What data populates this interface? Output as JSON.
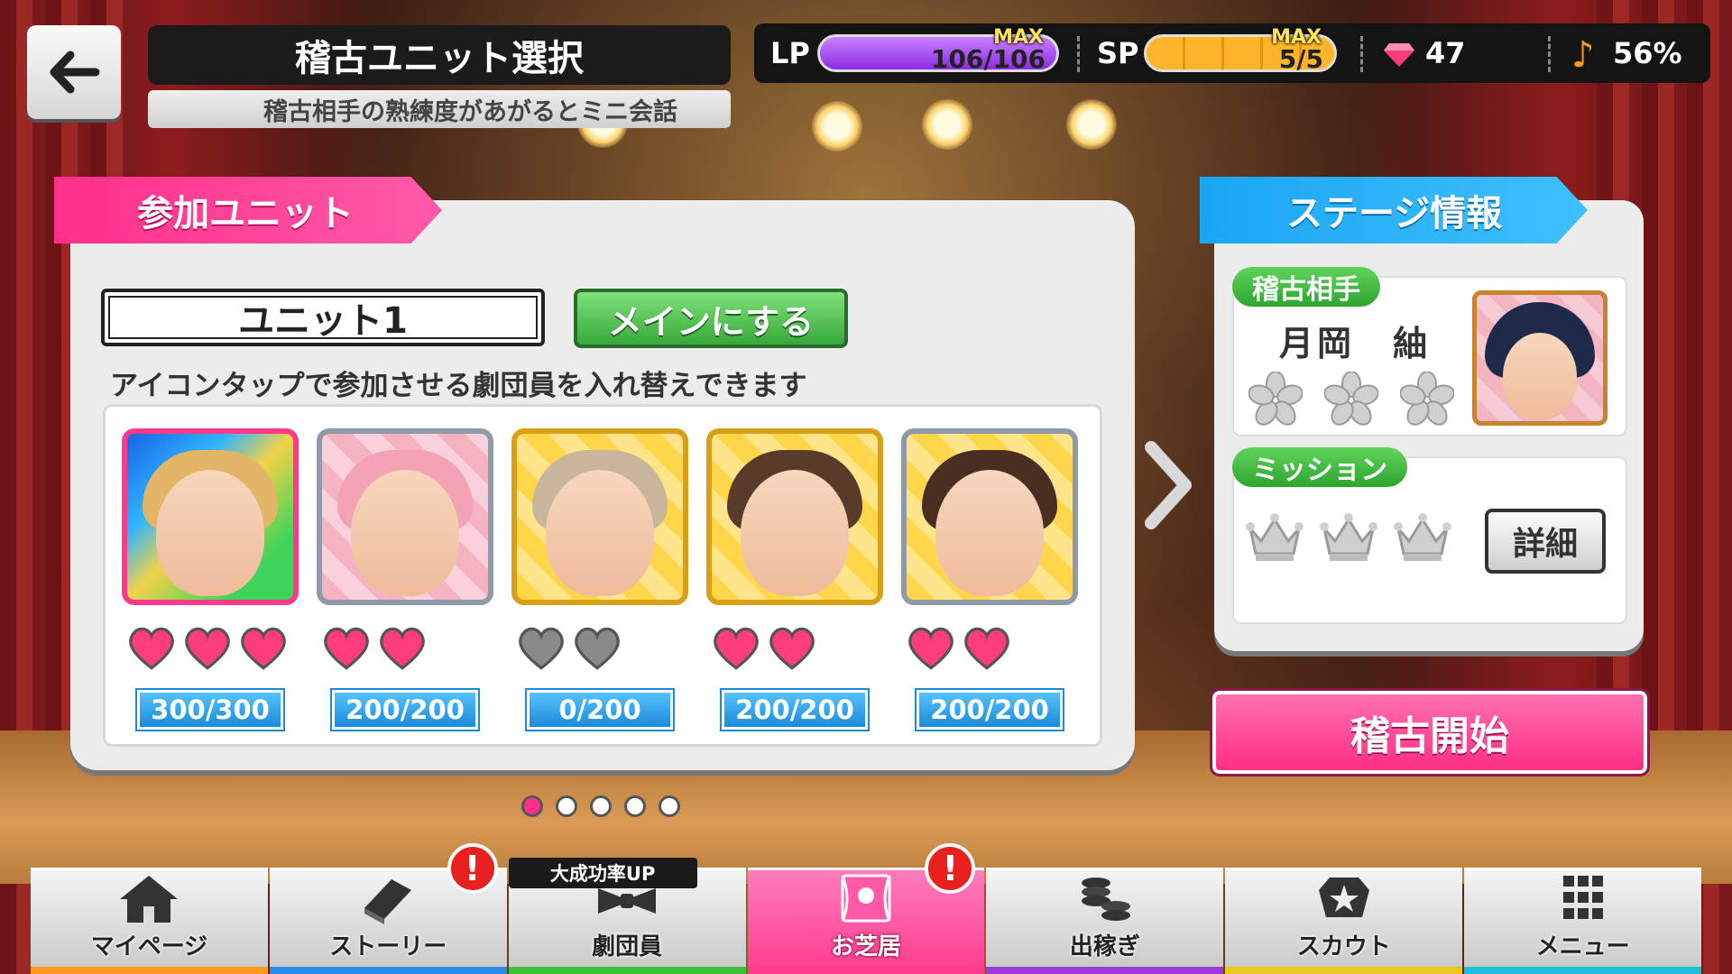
{
  "header": {
    "title": "稽古ユニット選択",
    "subtitle": "稽古相手の熟練度があがるとミニ会話"
  },
  "status": {
    "lp_label": "LP",
    "lp_value": "106/106",
    "lp_level": 1.0,
    "lp_max": "MAX",
    "sp_label": "SP",
    "sp_value": "5/5",
    "sp_level": 1.0,
    "sp_max": "MAX",
    "gems": "47",
    "note_percent": "56%"
  },
  "unit_panel": {
    "ribbon": "参加ユニット",
    "unit_name": "ユニット1",
    "main_button": "メインにする",
    "instruction": "アイコンタップで参加させる劇団員を入れ替えできます",
    "members": [
      {
        "exp": "300/300",
        "hearts_filled": 3,
        "hearts_total": 3
      },
      {
        "exp": "200/200",
        "hearts_filled": 2,
        "hearts_total": 2
      },
      {
        "exp": "0/200",
        "hearts_filled": 0,
        "hearts_total": 2
      },
      {
        "exp": "200/200",
        "hearts_filled": 2,
        "hearts_total": 2
      },
      {
        "exp": "200/200",
        "hearts_filled": 2,
        "hearts_total": 2
      }
    ],
    "page_count": 5,
    "page_active": 1
  },
  "stage_panel": {
    "ribbon": "ステージ情報",
    "opponent_tag": "稽古相手",
    "opponent_name": "月岡　紬",
    "mission_tag": "ミッション",
    "detail_button": "詳細",
    "start_button": "稽古開始"
  },
  "nav": {
    "items": [
      {
        "label": "マイページ",
        "icon": "home-icon",
        "strip": "#ff9a1a"
      },
      {
        "label": "ストーリー",
        "icon": "book-icon",
        "strip": "#2a8ae8",
        "alert": "!"
      },
      {
        "label": "劇団員",
        "icon": "bowtie-icon",
        "strip": "#3fbf3a",
        "tag": "大成功率UP"
      },
      {
        "label": "お芝居",
        "icon": "theater-icon",
        "strip": "#ff3b8e",
        "alert": "!"
      },
      {
        "label": "出稼ぎ",
        "icon": "coins-icon",
        "strip": "#9a3ad8"
      },
      {
        "label": "スカウト",
        "icon": "badge-icon",
        "strip": "#e8c81a"
      },
      {
        "label": "メニュー",
        "icon": "grid-icon",
        "strip": "#1abfd8"
      }
    ]
  }
}
